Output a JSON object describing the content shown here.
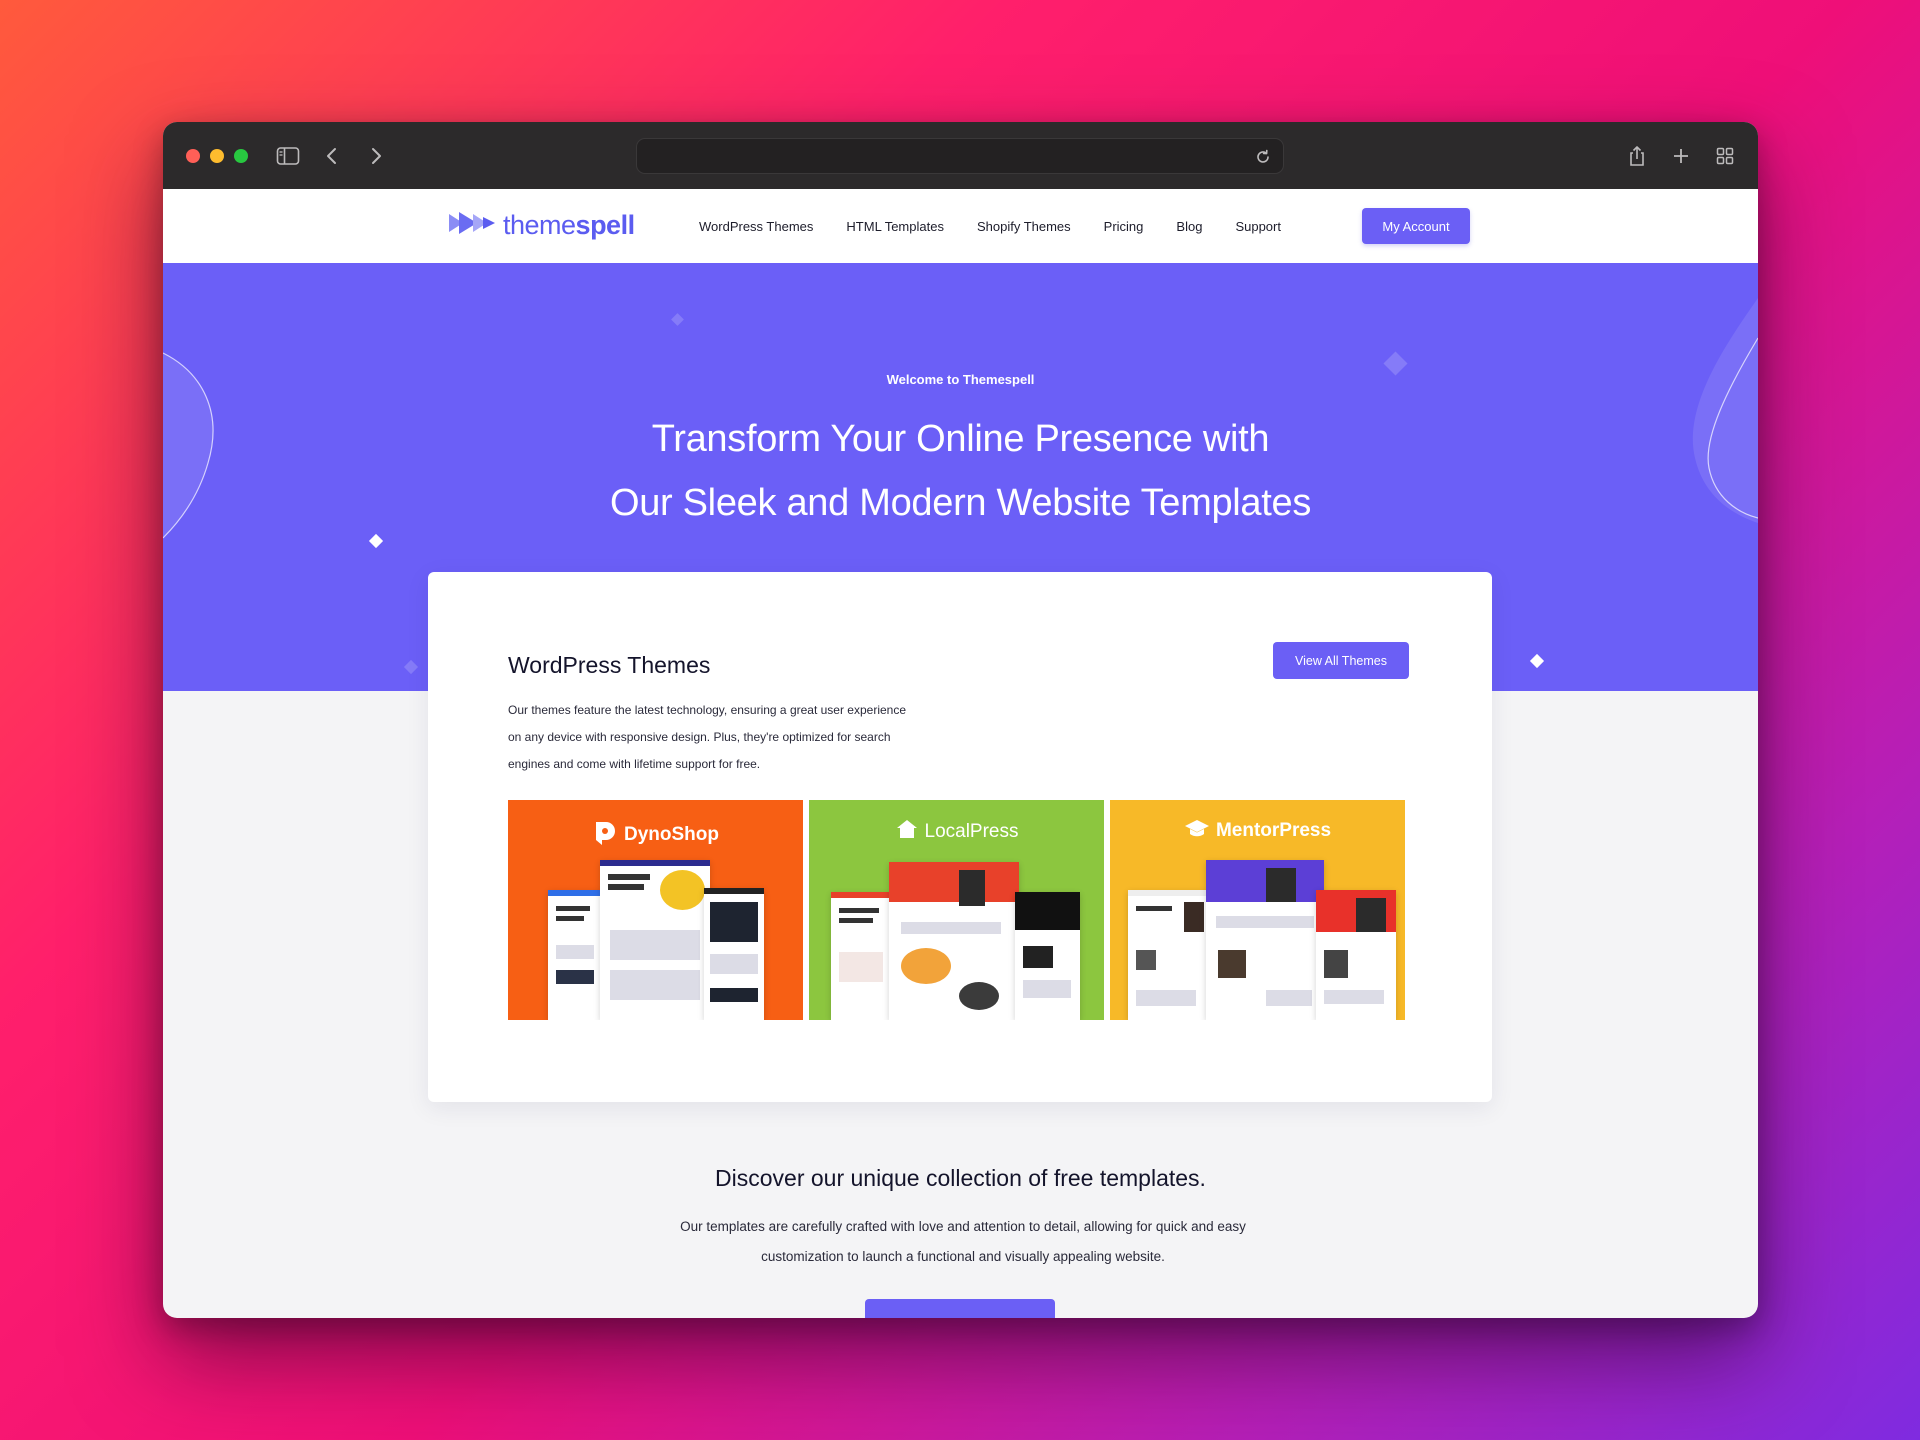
{
  "site": {
    "logo_text_light": "theme",
    "logo_text_bold": "spell",
    "nav": [
      "WordPress Themes",
      "HTML Templates",
      "Shopify Themes",
      "Pricing",
      "Blog",
      "Support"
    ],
    "account_button": "My Account"
  },
  "hero": {
    "welcome": "Welcome to Themespell",
    "headline_line1": "Transform Your Online Presence with",
    "headline_line2": "Our Sleek and Modern Website Templates"
  },
  "card": {
    "title": "WordPress Themes",
    "view_all": "View All Themes",
    "desc_line1": "Our themes feature the latest technology, ensuring a great user experience",
    "desc_line2": "on any device with responsive design. Plus, they're optimized for search",
    "desc_line3": "engines and come with lifetime support for free.",
    "themes": [
      {
        "name": "DynoShop",
        "color": "#f75f14"
      },
      {
        "name": "LocalPress",
        "color": "#8cc63f"
      },
      {
        "name": "MentorPress",
        "color": "#f7b928"
      }
    ]
  },
  "collection": {
    "title": "Discover our unique collection of free templates.",
    "desc_line1": "Our templates are carefully crafted with love and attention to detail, allowing for quick and easy",
    "desc_line2": "customization to launch a functional and visually appealing website."
  },
  "colors": {
    "brand": "#6b5ff5",
    "hero": "#6b5ff7",
    "titlebar": "#2c2a2b"
  },
  "icons": [
    "sidebar-icon",
    "back-icon",
    "forward-icon",
    "reload-icon",
    "share-icon",
    "new-tab-icon",
    "tabs-overview-icon",
    "logo-icon"
  ]
}
